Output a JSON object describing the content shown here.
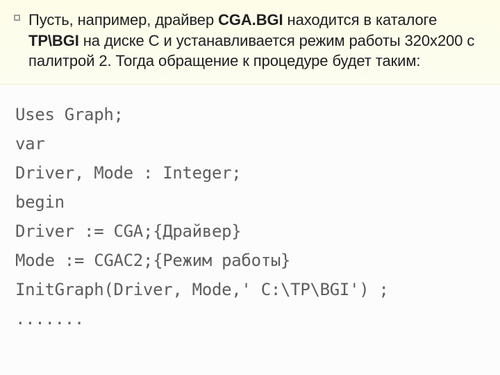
{
  "intro": {
    "pre1": "Пусть, например, драйвер ",
    "bold1": "CGA.BGI",
    "mid1": " находится в каталоге ",
    "bold2": "TP\\BGI",
    "rest": " на диске С и устанавливается режим работы 320х200 с палитрой 2. Тогда обращение к процедуре будет таким:"
  },
  "code": {
    "l1": "Uses Graph;",
    "l2": "var",
    "l3": "Driver, Mode : Integer;",
    "l4": "begin",
    "l5": "Driver := CGA;{Драйвер}",
    "l6": "Mode := CGAC2;{Режим работы}",
    "l7": "InitGraph(Driver, Mode,' C:\\TP\\BGI') ;",
    "l8": "......."
  }
}
